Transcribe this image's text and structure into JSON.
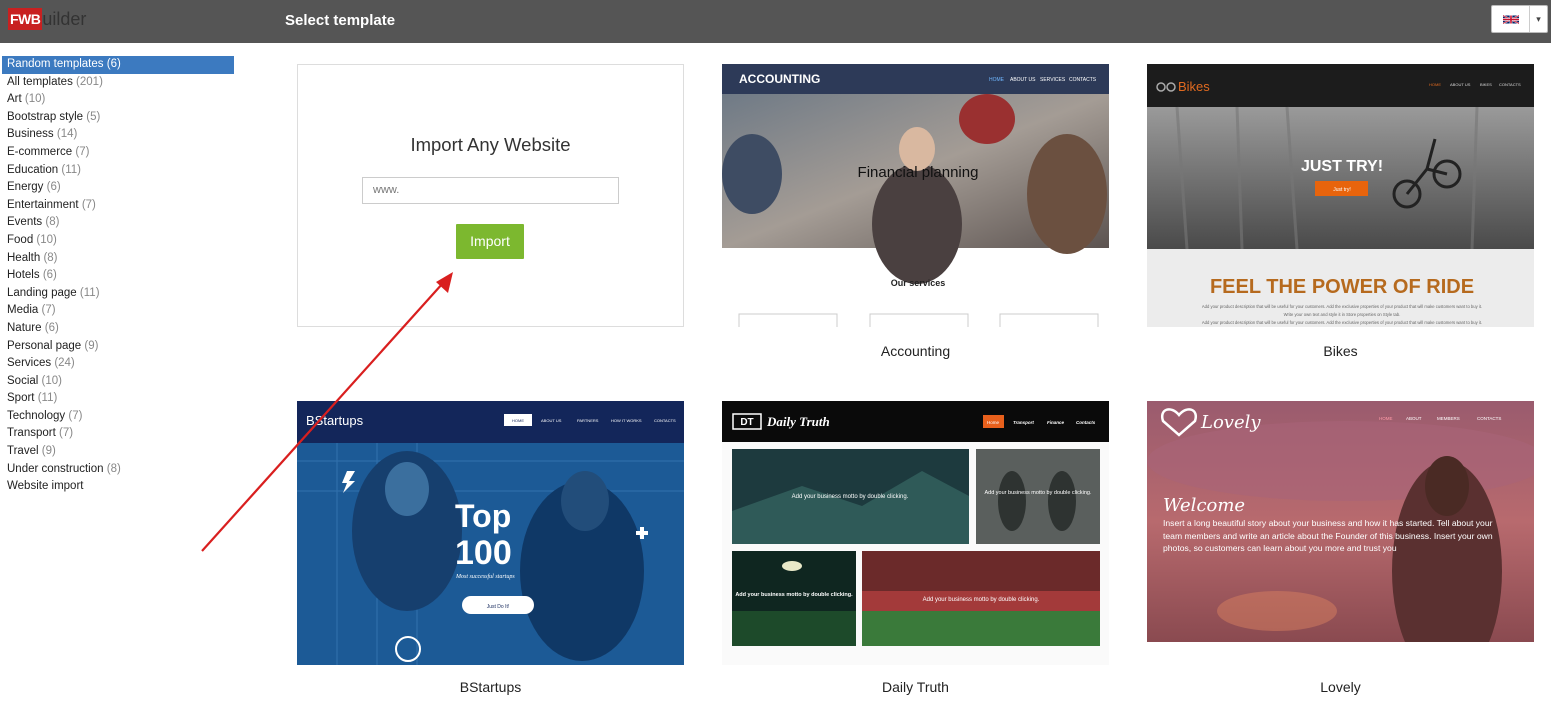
{
  "app": {
    "logo_fwb": "FWB",
    "logo_rest": "uilder"
  },
  "header": {
    "title": "Select template"
  },
  "language": {
    "flag": "uk-flag-icon",
    "caret": "▾"
  },
  "categories": [
    {
      "label": "Random templates",
      "count": "(6)"
    },
    {
      "label": "All templates",
      "count": "(201)"
    },
    {
      "label": "Art",
      "count": "(10)"
    },
    {
      "label": "Bootstrap style",
      "count": "(5)"
    },
    {
      "label": "Business",
      "count": "(14)"
    },
    {
      "label": "E-commerce",
      "count": "(7)"
    },
    {
      "label": "Education",
      "count": "(11)"
    },
    {
      "label": "Energy",
      "count": "(6)"
    },
    {
      "label": "Entertainment",
      "count": "(7)"
    },
    {
      "label": "Events",
      "count": "(8)"
    },
    {
      "label": "Food",
      "count": "(10)"
    },
    {
      "label": "Health",
      "count": "(8)"
    },
    {
      "label": "Hotels",
      "count": "(6)"
    },
    {
      "label": "Landing page",
      "count": "(11)"
    },
    {
      "label": "Media",
      "count": "(7)"
    },
    {
      "label": "Nature",
      "count": "(6)"
    },
    {
      "label": "Personal page",
      "count": "(9)"
    },
    {
      "label": "Services",
      "count": "(24)"
    },
    {
      "label": "Social",
      "count": "(10)"
    },
    {
      "label": "Sport",
      "count": "(11)"
    },
    {
      "label": "Technology",
      "count": "(7)"
    },
    {
      "label": "Transport",
      "count": "(7)"
    },
    {
      "label": "Travel",
      "count": "(9)"
    },
    {
      "label": "Under construction",
      "count": "(8)"
    },
    {
      "label": "Website import",
      "count": ""
    }
  ],
  "import": {
    "title": "Import Any Website",
    "placeholder": "www.",
    "button": "Import"
  },
  "templates": {
    "accounting": {
      "caption": "Accounting",
      "brand": "ACCOUNTING",
      "nav": [
        "HOME",
        "ABOUT US",
        "SERVICES",
        "CONTACTS"
      ],
      "hero": "Financial planning",
      "section": "Our services"
    },
    "bikes": {
      "caption": "Bikes",
      "brand": "Bikes",
      "nav": [
        "HOME",
        "ABOUT US",
        "BIKES",
        "CONTACTS"
      ],
      "hero": "JUST TRY!",
      "cta": "Just try!",
      "headline": "FEEL THE POWER OF RIDE",
      "body": [
        "Add your product description that will be useful for your customers. Add the exclusive properties of your product that will make customers want to buy it.",
        "Write your own text and style it in Store properties on Style tab.",
        "Add your product description that will be useful for your customers. Add the exclusive properties of your product that will make customers want to buy it."
      ]
    },
    "bstartups": {
      "caption": "BStartups",
      "brand": "BStartups",
      "nav": [
        "HOME",
        "ABOUT US",
        "PARTNERS",
        "HOW IT WORKS",
        "CONTACTS"
      ],
      "hero_top": "Top",
      "hero_num": "100",
      "hero_sub": "Most successful startups",
      "cta": "Just Do It!"
    },
    "daily_truth": {
      "caption": "Daily Truth",
      "brand_box": "DT",
      "brand": "Daily Truth",
      "nav": [
        "Home",
        "Transport",
        "Finance",
        "Contacts"
      ],
      "motto": "Add your business motto by double clicking."
    },
    "lovely": {
      "caption": "Lovely",
      "brand": "Lovely",
      "nav": [
        "HOME",
        "ABOUT",
        "MEMBERS",
        "CONTACTS"
      ],
      "hero": "Welcome",
      "body": "Insert a long beautiful story about your business and how it has started. Tell about your team members and write an article about the Founder of this business. Insert your own photos, so customers can learn about you more and trust you"
    }
  },
  "colors": {
    "topbar": "#555555",
    "active": "#3c7ac0",
    "import_button": "#7cb82f",
    "annotation_arrow": "#d91f1f"
  }
}
